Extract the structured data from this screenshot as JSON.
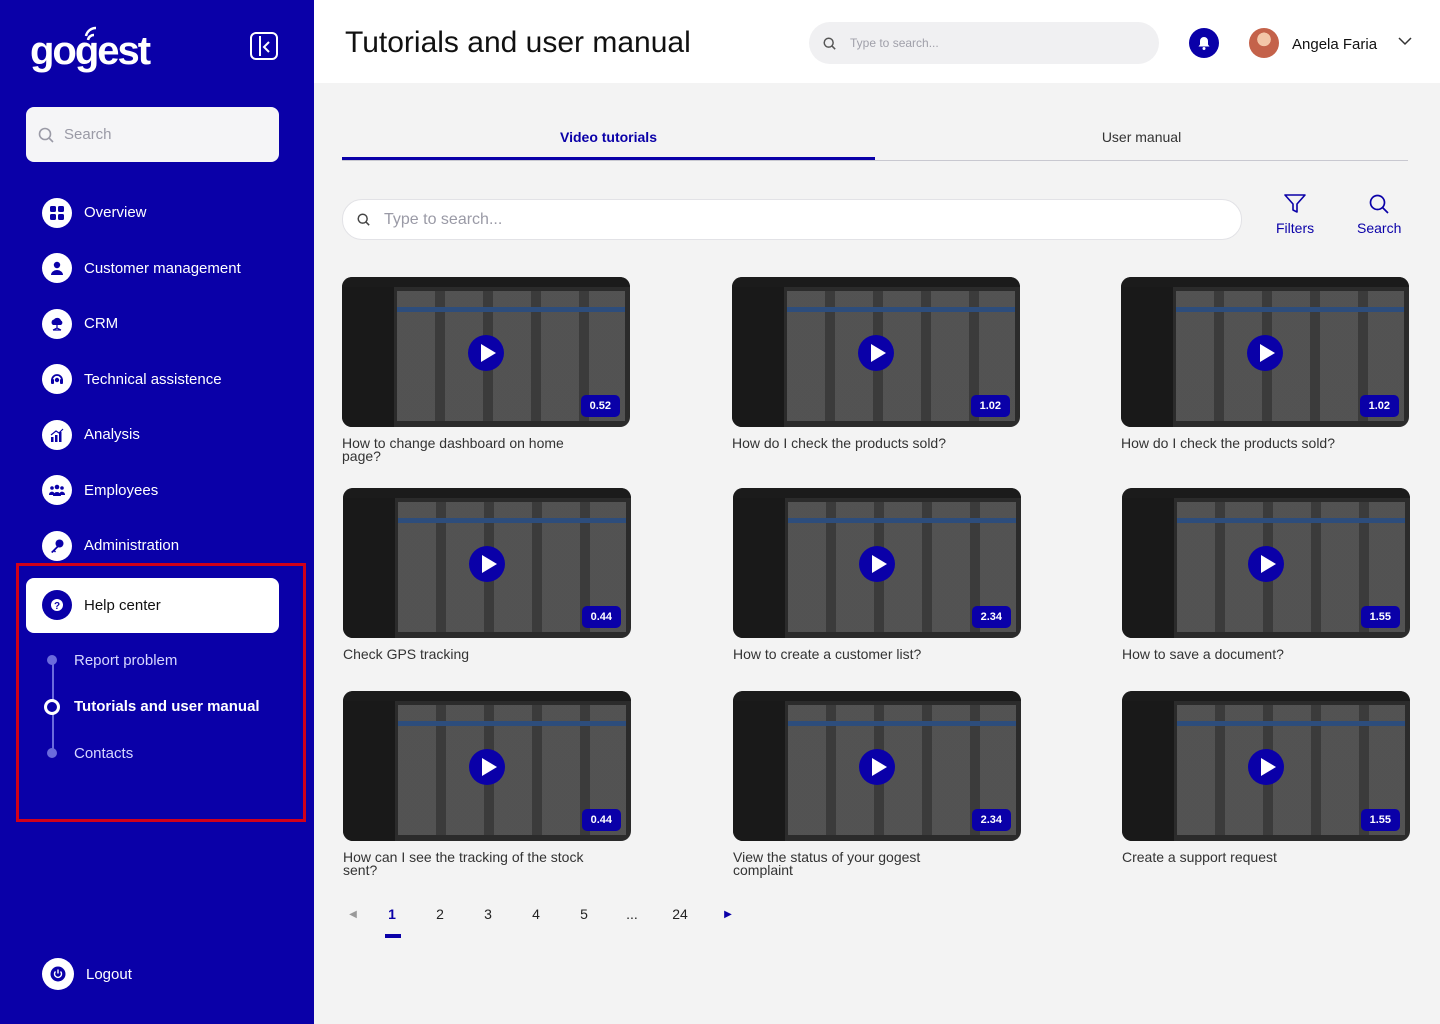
{
  "app": {
    "brand": "gogest",
    "accent": "#0a00a8",
    "highlight_box_color": "#d2001a"
  },
  "sidebar": {
    "search_placeholder": "Search",
    "items": [
      {
        "label": "Overview",
        "icon": "grid-icon"
      },
      {
        "label": "Customer management",
        "icon": "user-icon"
      },
      {
        "label": "CRM",
        "icon": "cloud-network-icon"
      },
      {
        "label": "Technical assistence",
        "icon": "headset-icon"
      },
      {
        "label": "Analysis",
        "icon": "chart-icon"
      },
      {
        "label": "Employees",
        "icon": "people-icon"
      },
      {
        "label": "Administration",
        "icon": "key-icon"
      },
      {
        "label": "Help center",
        "icon": "question-icon"
      }
    ],
    "sub_items": [
      {
        "label": "Report problem"
      },
      {
        "label": "Tutorials and user manual"
      },
      {
        "label": "Contacts"
      }
    ],
    "logout_label": "Logout"
  },
  "header": {
    "title": "Tutorials and user manual",
    "search_placeholder": "Type to search...",
    "user_name": "Angela Faria"
  },
  "tabs": [
    {
      "label": "Video tutorials"
    },
    {
      "label": "User manual"
    }
  ],
  "main": {
    "search_placeholder": "Type to search...",
    "filters_label": "Filters",
    "search_label": "Search"
  },
  "videos": [
    {
      "title": "How to change dashboard on home page?",
      "duration": "0.52"
    },
    {
      "title": "How do I check the products sold?",
      "duration": "1.02"
    },
    {
      "title": "How do I check the products sold?",
      "duration": "1.02"
    },
    {
      "title": "Check GPS tracking",
      "duration": "0.44"
    },
    {
      "title": "How to create a customer list?",
      "duration": "2.34"
    },
    {
      "title": "How to save a document?",
      "duration": "1.55"
    },
    {
      "title": "How can I see the tracking of the stock sent?",
      "duration": "0.44"
    },
    {
      "title": "View the status of your gogest complaint",
      "duration": "2.34"
    },
    {
      "title": "Create a support request",
      "duration": "1.55"
    }
  ],
  "pagination": {
    "pages": [
      "1",
      "2",
      "3",
      "4",
      "5",
      "...",
      "24"
    ],
    "current": "1"
  }
}
